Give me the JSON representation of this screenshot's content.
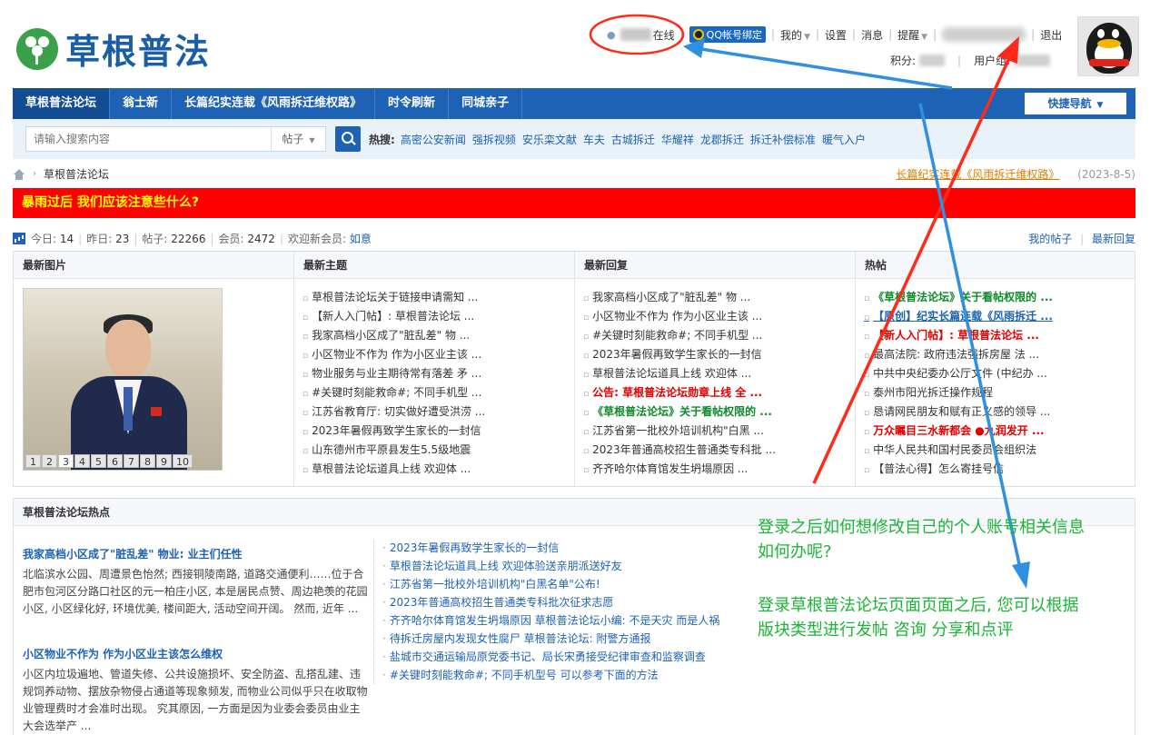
{
  "site": {
    "logo_text": "草根普法"
  },
  "user_bar": {
    "online": "在线",
    "qq_bind": "QQ帐号绑定",
    "my": "我的",
    "settings": "设置",
    "messages": "消息",
    "reminders": "提醒",
    "logout": "退出",
    "points_label": "积分:",
    "group_label": "用户组:"
  },
  "nav": {
    "items": [
      "草根普法论坛",
      "翁士新",
      "长篇纪实连载《风雨拆迁维权路》",
      "时令刷新",
      "同城亲子"
    ],
    "quick_nav": "快捷导航"
  },
  "search": {
    "placeholder": "请输入搜索内容",
    "type": "帖子",
    "hot_label": "热搜:",
    "hot_keywords": [
      "高密公安新闻",
      "强拆视频",
      "安乐栾文献",
      "车夫",
      "古城拆迁",
      "华耀祥",
      "龙郡拆迁",
      "拆迁补偿标准",
      "暖气入户"
    ]
  },
  "breadcrumb": {
    "current": "草根普法论坛"
  },
  "serial": {
    "link": "长篇纪实连载《风雨拆迁维权路》",
    "date": "(2023-8-5)"
  },
  "notice": "暴雨过后 我们应该注意些什么?",
  "stats": {
    "today_label": "今日:",
    "today": "14",
    "yesterday_label": "昨日:",
    "yesterday": "23",
    "posts_label": "帖子:",
    "posts": "22266",
    "members_label": "会员:",
    "members": "2472",
    "welcome_label": "欢迎新会员:",
    "new_member": "如意",
    "my_posts": "我的帖子",
    "latest_reply": "最新回复"
  },
  "panel": {
    "titles": [
      "最新图片",
      "最新主题",
      "最新回复",
      "热帖"
    ],
    "photo_pages": [
      "1",
      "2",
      "3",
      "4",
      "5",
      "6",
      "7",
      "8",
      "9",
      "10"
    ],
    "latest_topics": [
      "草根普法论坛关于链接申请需知 ...",
      "【新人入门帖】: 草根普法论坛 ...",
      "我家高档小区成了\"脏乱差\" 物 ...",
      "小区物业不作为 作为小区业主该 ...",
      "物业服务与业主期待常有落差 矛 ...",
      "#关键时刻能救命#; 不同手机型 ...",
      "江苏省教育厅: 切实做好遭受洪涝 ...",
      "2023年暑假再致学生家长的一封信",
      "山东德州市平原县发生5.5级地震",
      "草根普法论坛道具上线 欢迎体 ..."
    ],
    "latest_replies": [
      "我家高档小区成了\"脏乱差\" 物 ...",
      "小区物业不作为 作为小区业主该 ...",
      "#关键时刻能救命#; 不同手机型 ...",
      "2023年暑假再致学生家长的一封信",
      "草根普法论坛道具上线 欢迎体 ...",
      "公告: 草根普法论坛勋章上线 全 ...",
      "《草根普法论坛》关于看帖权限的 ...",
      "江苏省第一批校外培训机构\"白黑 ...",
      "2023年普通高校招生普通类专科批 ...",
      "齐齐哈尔体育馆发生坍塌原因 ..."
    ],
    "hot_posts": [
      "《草根普法论坛》关于看帖权限的 ...",
      "【原创】纪实长篇连载《风雨拆迁 ...",
      "【新人入门帖】: 草根普法论坛 ...",
      "最高法院: 政府违法强拆房屋 法 ...",
      "中共中央纪委办公厅文件 (中纪办 ...",
      "泰州市阳光拆迁操作规程",
      "恳请网民朋友和赋有正义感的领导 ...",
      "万众瞩目三水新都会 ●九润发开 ...",
      "中华人民共和国村民委员会组织法",
      "【普法心得】怎么寄挂号信"
    ]
  },
  "hot_section": {
    "title": "草根普法论坛热点",
    "articles": [
      {
        "title": "我家高档小区成了\"脏乱差\" 物业: 业主们任性",
        "body": "北临滨水公园、周遭景色怡然; 西接铜陵南路, 道路交通便利……位于合肥市包河区分路口社区的元一柏庄小区, 本是居民点赞、周边艳羡的花园小区, 小区绿化好, 环境优美, 楼间距大, 活动空间开阔。 然而, 近年 ..."
      },
      {
        "title": "小区物业不作为 作为小区业主该怎么维权",
        "body": "小区内垃圾遍地、管道失修、公共设施损坏、安全防盗、乱搭乱建、违规饲养动物、摆放杂物侵占通道等现象频发, 而物业公司似乎只在收取物业管理费时才会准时出现。 究其原因, 一方面是因为业委会委员由业主大会选举产 ..."
      }
    ],
    "list": [
      "2023年暑假再致学生家长的一封信",
      "草根普法论坛道具上线 欢迎体验送亲朋派送好友",
      "江苏省第一批校外培训机构\"白黑名单\"公布!",
      "2023年普通高校招生普通类专科批次征求志愿",
      "齐齐哈尔体育馆发生坍塌原因 草根普法论坛小编: 不是天灾 而是人祸",
      "待拆迁房屋内发现女性腐尸 草根普法论坛: 附警方通报",
      "盐城市交通运输局原党委书记、局长宋勇接受纪律审查和监察调查",
      "#关键时刻能救命#; 不同手机型号 可以参考下面的方法"
    ]
  },
  "annotations": {
    "question_line1": "登录之后如何想修改自己的个人账号相关信息",
    "question_line2": "如何办呢?",
    "answer_line1": "登录草根普法论坛页面页面之后, 您可以根据",
    "answer_line2": "版块类型进行发帖 咨询 分享和点评",
    "colors": {
      "red": "#ff2a1a",
      "blue": "#2f8fe0",
      "green": "#1bb536"
    }
  }
}
